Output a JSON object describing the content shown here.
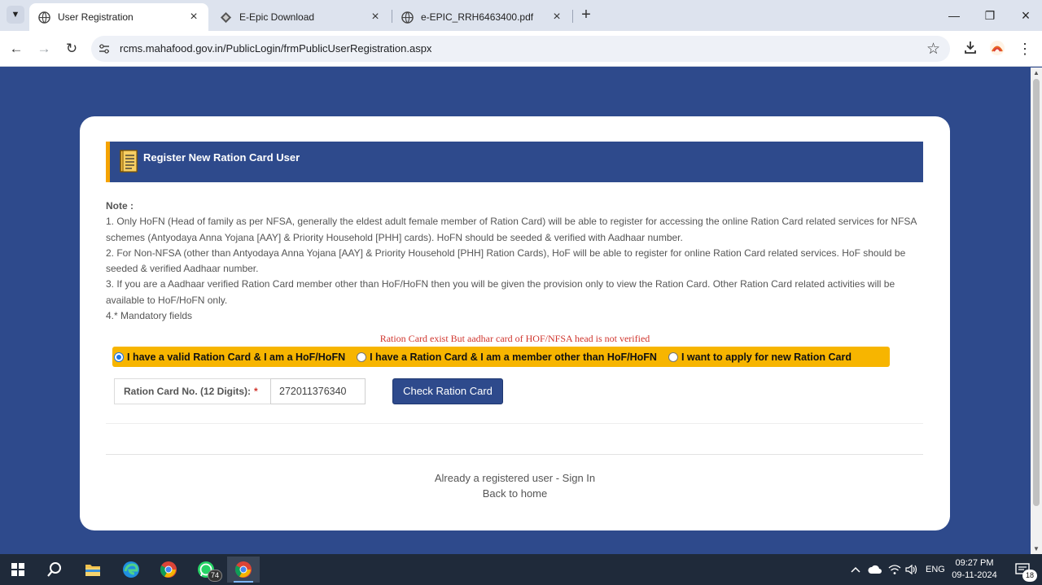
{
  "browser": {
    "tabs": [
      {
        "title": "User Registration",
        "active": true
      },
      {
        "title": "E-Epic Download",
        "active": false
      },
      {
        "title": "e-EPIC_RRH6463400.pdf",
        "active": false
      }
    ],
    "url": "rcms.mahafood.gov.in/PublicLogin/frmPublicUserRegistration.aspx"
  },
  "page": {
    "header_title": "Register New Ration Card User",
    "note_title": "Note :",
    "notes": [
      "1. Only HoFN (Head of family as per NFSA, generally the eldest adult female member of Ration Card) will be able to register for accessing the online Ration Card related services for NFSA schemes (Antyodaya Anna Yojana [AAY] & Priority Household [PHH] cards). HoFN should be seeded & verified with Aadhaar number.",
      "2. For Non-NFSA (other than Antyodaya Anna Yojana [AAY] & Priority Household [PHH] Ration Cards), HoF will be able to register for online Ration Card related services. HoF should be seeded & verified Aadhaar number.",
      "3. If you are a Aadhaar verified Ration Card member other than HoF/HoFN then you will be given the provision only to view the Ration Card. Other Ration Card related activities will be available to HoF/HoFN only.",
      "4.* Mandatory fields"
    ],
    "warning": "Ration Card exist But aadhar card of HOF/NFSA head is not verified",
    "radio_options": [
      {
        "label": "I have a valid Ration Card & I am a HoF/HoFN",
        "checked": true
      },
      {
        "label": "I have a Ration Card & I am a member other than HoF/HoFN",
        "checked": false
      },
      {
        "label": "I want to apply for new Ration Card",
        "checked": false
      }
    ],
    "rc_label": "Ration Card No. (12 Digits):",
    "rc_required": "*",
    "rc_value": "272011376340",
    "check_button": "Check Ration Card",
    "sign_in_link": "Already a registered user - Sign In",
    "home_link": "Back to home"
  },
  "taskbar": {
    "whatsapp_badge": "74",
    "language": "ENG",
    "time": "09:27 PM",
    "date": "09-11-2024",
    "notification_count": "18"
  },
  "colors": {
    "brand_blue": "#2e4a8c",
    "accent_yellow": "#f7b500",
    "warning_red": "#d0342c"
  }
}
